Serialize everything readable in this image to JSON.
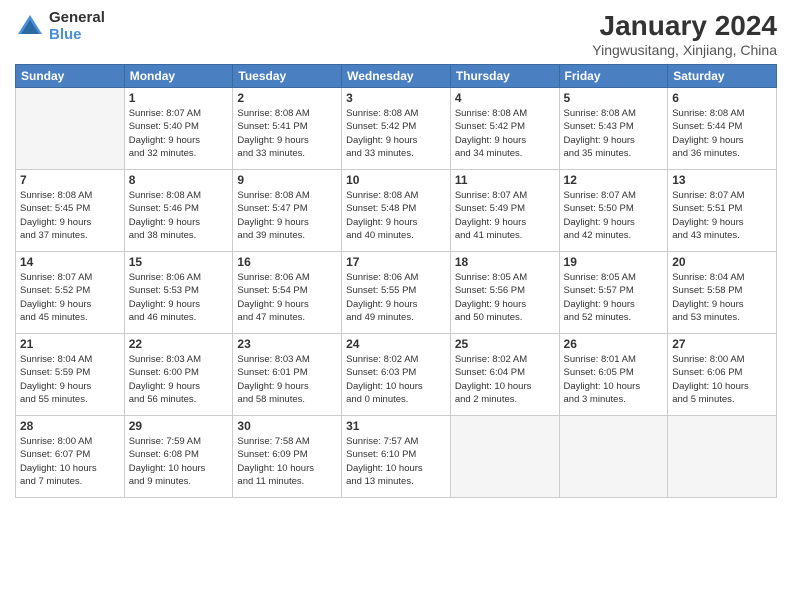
{
  "logo": {
    "general": "General",
    "blue": "Blue"
  },
  "header": {
    "month": "January 2024",
    "location": "Yingwusitang, Xinjiang, China"
  },
  "days_of_week": [
    "Sunday",
    "Monday",
    "Tuesday",
    "Wednesday",
    "Thursday",
    "Friday",
    "Saturday"
  ],
  "weeks": [
    [
      {
        "day": "",
        "info": ""
      },
      {
        "day": "1",
        "info": "Sunrise: 8:07 AM\nSunset: 5:40 PM\nDaylight: 9 hours\nand 32 minutes."
      },
      {
        "day": "2",
        "info": "Sunrise: 8:08 AM\nSunset: 5:41 PM\nDaylight: 9 hours\nand 33 minutes."
      },
      {
        "day": "3",
        "info": "Sunrise: 8:08 AM\nSunset: 5:42 PM\nDaylight: 9 hours\nand 33 minutes."
      },
      {
        "day": "4",
        "info": "Sunrise: 8:08 AM\nSunset: 5:42 PM\nDaylight: 9 hours\nand 34 minutes."
      },
      {
        "day": "5",
        "info": "Sunrise: 8:08 AM\nSunset: 5:43 PM\nDaylight: 9 hours\nand 35 minutes."
      },
      {
        "day": "6",
        "info": "Sunrise: 8:08 AM\nSunset: 5:44 PM\nDaylight: 9 hours\nand 36 minutes."
      }
    ],
    [
      {
        "day": "7",
        "info": "Sunrise: 8:08 AM\nSunset: 5:45 PM\nDaylight: 9 hours\nand 37 minutes."
      },
      {
        "day": "8",
        "info": "Sunrise: 8:08 AM\nSunset: 5:46 PM\nDaylight: 9 hours\nand 38 minutes."
      },
      {
        "day": "9",
        "info": "Sunrise: 8:08 AM\nSunset: 5:47 PM\nDaylight: 9 hours\nand 39 minutes."
      },
      {
        "day": "10",
        "info": "Sunrise: 8:08 AM\nSunset: 5:48 PM\nDaylight: 9 hours\nand 40 minutes."
      },
      {
        "day": "11",
        "info": "Sunrise: 8:07 AM\nSunset: 5:49 PM\nDaylight: 9 hours\nand 41 minutes."
      },
      {
        "day": "12",
        "info": "Sunrise: 8:07 AM\nSunset: 5:50 PM\nDaylight: 9 hours\nand 42 minutes."
      },
      {
        "day": "13",
        "info": "Sunrise: 8:07 AM\nSunset: 5:51 PM\nDaylight: 9 hours\nand 43 minutes."
      }
    ],
    [
      {
        "day": "14",
        "info": "Sunrise: 8:07 AM\nSunset: 5:52 PM\nDaylight: 9 hours\nand 45 minutes."
      },
      {
        "day": "15",
        "info": "Sunrise: 8:06 AM\nSunset: 5:53 PM\nDaylight: 9 hours\nand 46 minutes."
      },
      {
        "day": "16",
        "info": "Sunrise: 8:06 AM\nSunset: 5:54 PM\nDaylight: 9 hours\nand 47 minutes."
      },
      {
        "day": "17",
        "info": "Sunrise: 8:06 AM\nSunset: 5:55 PM\nDaylight: 9 hours\nand 49 minutes."
      },
      {
        "day": "18",
        "info": "Sunrise: 8:05 AM\nSunset: 5:56 PM\nDaylight: 9 hours\nand 50 minutes."
      },
      {
        "day": "19",
        "info": "Sunrise: 8:05 AM\nSunset: 5:57 PM\nDaylight: 9 hours\nand 52 minutes."
      },
      {
        "day": "20",
        "info": "Sunrise: 8:04 AM\nSunset: 5:58 PM\nDaylight: 9 hours\nand 53 minutes."
      }
    ],
    [
      {
        "day": "21",
        "info": "Sunrise: 8:04 AM\nSunset: 5:59 PM\nDaylight: 9 hours\nand 55 minutes."
      },
      {
        "day": "22",
        "info": "Sunrise: 8:03 AM\nSunset: 6:00 PM\nDaylight: 9 hours\nand 56 minutes."
      },
      {
        "day": "23",
        "info": "Sunrise: 8:03 AM\nSunset: 6:01 PM\nDaylight: 9 hours\nand 58 minutes."
      },
      {
        "day": "24",
        "info": "Sunrise: 8:02 AM\nSunset: 6:03 PM\nDaylight: 10 hours\nand 0 minutes."
      },
      {
        "day": "25",
        "info": "Sunrise: 8:02 AM\nSunset: 6:04 PM\nDaylight: 10 hours\nand 2 minutes."
      },
      {
        "day": "26",
        "info": "Sunrise: 8:01 AM\nSunset: 6:05 PM\nDaylight: 10 hours\nand 3 minutes."
      },
      {
        "day": "27",
        "info": "Sunrise: 8:00 AM\nSunset: 6:06 PM\nDaylight: 10 hours\nand 5 minutes."
      }
    ],
    [
      {
        "day": "28",
        "info": "Sunrise: 8:00 AM\nSunset: 6:07 PM\nDaylight: 10 hours\nand 7 minutes."
      },
      {
        "day": "29",
        "info": "Sunrise: 7:59 AM\nSunset: 6:08 PM\nDaylight: 10 hours\nand 9 minutes."
      },
      {
        "day": "30",
        "info": "Sunrise: 7:58 AM\nSunset: 6:09 PM\nDaylight: 10 hours\nand 11 minutes."
      },
      {
        "day": "31",
        "info": "Sunrise: 7:57 AM\nSunset: 6:10 PM\nDaylight: 10 hours\nand 13 minutes."
      },
      {
        "day": "",
        "info": ""
      },
      {
        "day": "",
        "info": ""
      },
      {
        "day": "",
        "info": ""
      }
    ]
  ]
}
